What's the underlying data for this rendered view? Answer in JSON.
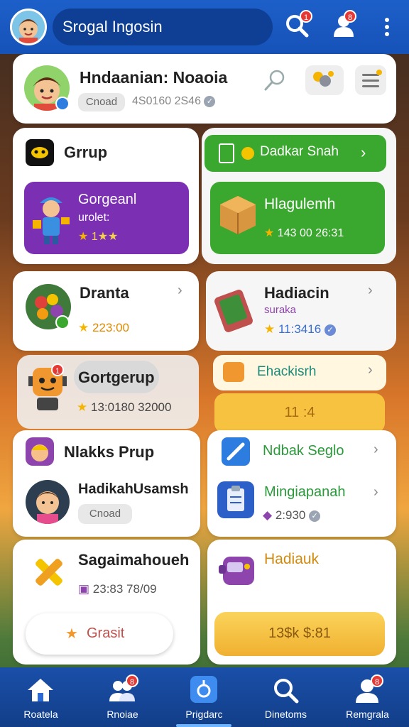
{
  "topbar": {
    "title": "Srogal Ingosin",
    "badge_search": "1",
    "badge_profile": "8"
  },
  "profile": {
    "name": "Hndaanian: Noaoia",
    "chip": "Cnoad",
    "meta": "4S0160 2S46"
  },
  "grup": {
    "title": "Grrup",
    "promo_title": "Gorgeanl",
    "promo_sub": "urolet:",
    "promo_rating": "1★★",
    "promo_rating_prefix": "★"
  },
  "green_button": {
    "label": "Dadkar Snah"
  },
  "green_card": {
    "title": "Hlagulemh",
    "value": "143 00 26:31"
  },
  "dranta": {
    "title": "Dranta",
    "value": "223:00"
  },
  "hadiacin": {
    "title": "Hadiacin",
    "sub": "suraka",
    "value": "11:3416"
  },
  "gortgerup": {
    "title": "Gortgerup",
    "value": "13:0180 32000",
    "badge": "1"
  },
  "ehackisrh": {
    "title": "Ehackisrh",
    "bar_label": "11 :4"
  },
  "nlakks": {
    "title": "Nlakks Prup",
    "user_name": "HadikahUsamsh",
    "chip": "Cnoad"
  },
  "ndbak": {
    "title": "Ndbak Seglo"
  },
  "mingiapanah": {
    "title": "Mingiapanah",
    "value": "2:930"
  },
  "sagaimahoueh": {
    "title": "Sagaimahoueh",
    "value": "23:83 78/09",
    "button": "Grasit"
  },
  "hadiauk": {
    "title": "Hadiauk",
    "button": "13$k $:81"
  },
  "nav": [
    {
      "label": "Roatela"
    },
    {
      "label": "Rnoiae",
      "badge": "8"
    },
    {
      "label": "Prigdarc"
    },
    {
      "label": "Dinetoms"
    },
    {
      "label": "Remgrala",
      "badge": "8"
    }
  ],
  "colors": {
    "primary": "#1d5fc9",
    "green": "#3aa72f",
    "purple": "#7b2fb3",
    "yellow": "#f6c240"
  }
}
